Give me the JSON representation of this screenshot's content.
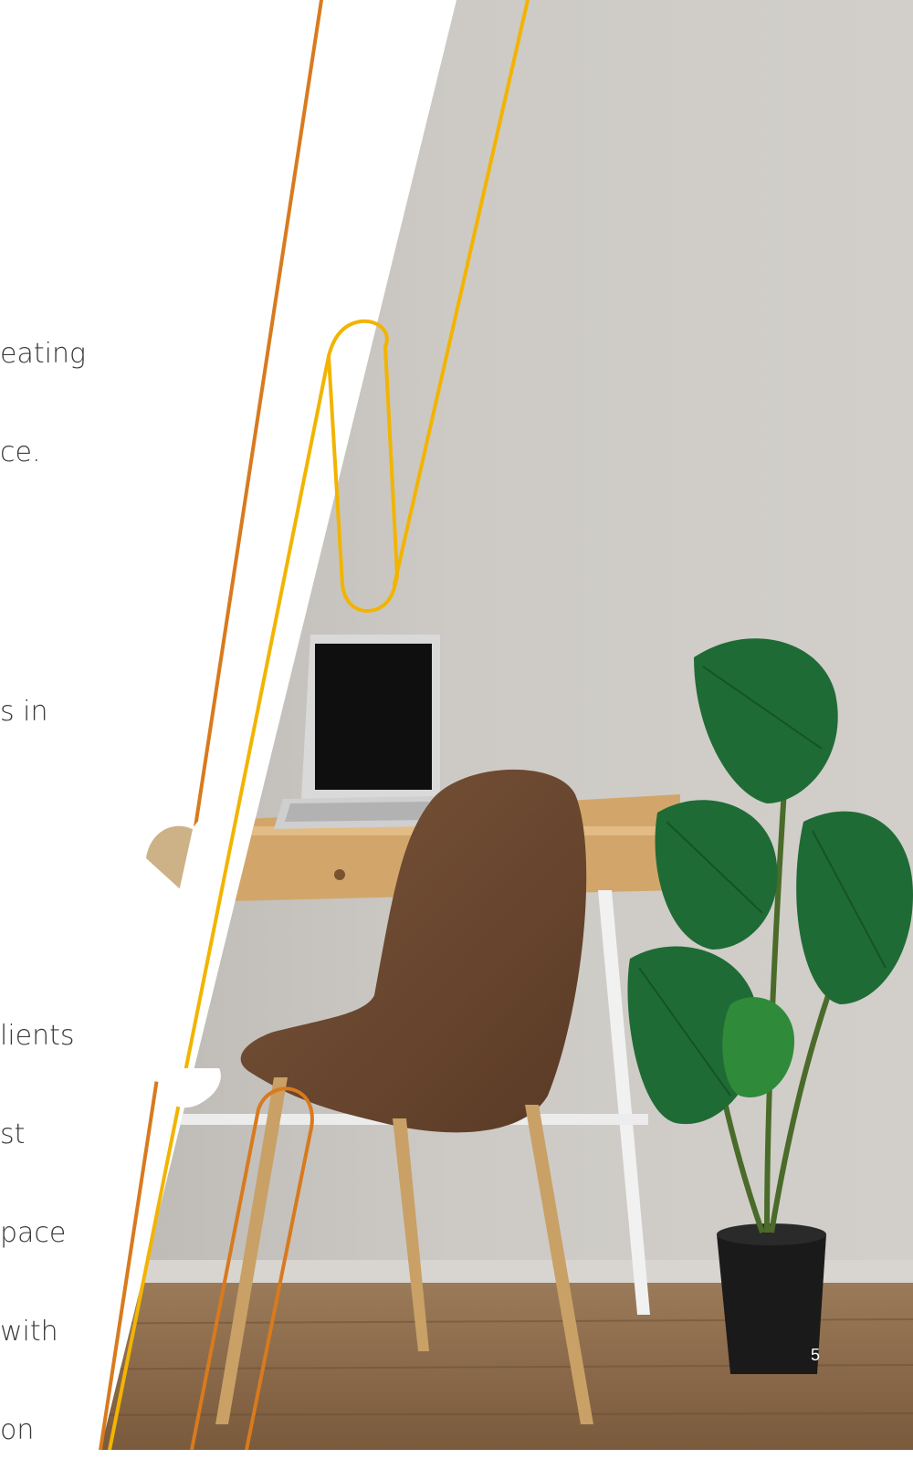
{
  "slide": {
    "text_block_1": [
      "eating",
      "ce."
    ],
    "text_block_2": [
      "s in"
    ],
    "text_block_3": [
      "lients",
      "st",
      "pace",
      "with",
      "on"
    ],
    "page_number": "5"
  },
  "colors": {
    "wall": "#c9c6c0",
    "floor": "#8a6a4a",
    "desk_wood": "#d4a86a",
    "chair_brown": "#6e4a32",
    "leaf_green": "#1f6b35",
    "pot": "#1a1a1a",
    "accent_orange": "#d87a1e",
    "accent_yellow": "#f2b400"
  }
}
